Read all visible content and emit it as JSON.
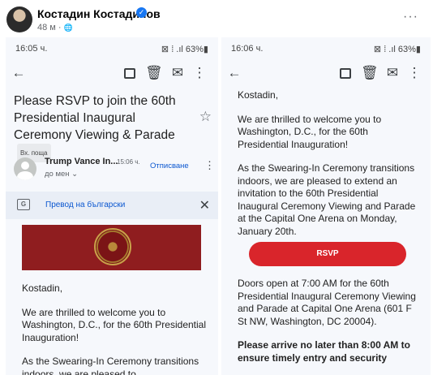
{
  "post": {
    "author": "Костадин Костадинов",
    "verified": "✓",
    "time": "48 м · ",
    "globe": "🌐",
    "more": "···"
  },
  "left_phone": {
    "status_time": "16:05 ч.",
    "status_icons": "⊠ ⁞ .ıl 63%▮",
    "subject": "Please RSVP to join the 60th Presidential Inaugural Ceremony Viewing & Parade",
    "inbox_chip": "Вх. поща",
    "sender_name": "Trump Vance In...",
    "sender_time": "15:06 ч.",
    "sender_to": "до мен ⌄",
    "unsubscribe": "Отписване",
    "translate": "Превод на български",
    "greeting": "Kostadin,",
    "para1": "We are thrilled to welcome you to Washington, D.C., for the 60th Presidential Inauguration!",
    "para2": "As the Swearing-In Ceremony transitions indoors, we are pleased to"
  },
  "right_phone": {
    "status_time": "16:06 ч.",
    "status_icons": "⊠ ⁞ .ıl 63%▮",
    "greeting": "Kostadin,",
    "para1": "We are thrilled to welcome you to Washington, D.C., for the 60th Presidential Inauguration!",
    "para2": "As the Swearing-In Ceremony transitions indoors, we are pleased to extend an invitation to the 60th Presidential Inaugural Ceremony Viewing and Parade at the Capital One Arena on Monday, January 20th.",
    "rsvp": "RSVP",
    "para3": "Doors open at 7:00 AM for the 60th Presidential Inaugural Ceremony Viewing and Parade at Capital One Arena (601 F St NW, Washington, DC 20004).",
    "para4": "Please arrive no later than 8:00 AM to ensure timely entry and security"
  },
  "icons": {
    "back": "back-arrow-icon",
    "archive": "archive-icon",
    "delete": "trash-icon",
    "mark_unread": "mark-unread-icon",
    "more": "more-vert-icon",
    "star": "star-icon"
  },
  "colors": {
    "rsvp_button": "#d9252b",
    "banner": "#8f1d1f",
    "link": "#0b57d0",
    "verified": "#1877f2"
  }
}
